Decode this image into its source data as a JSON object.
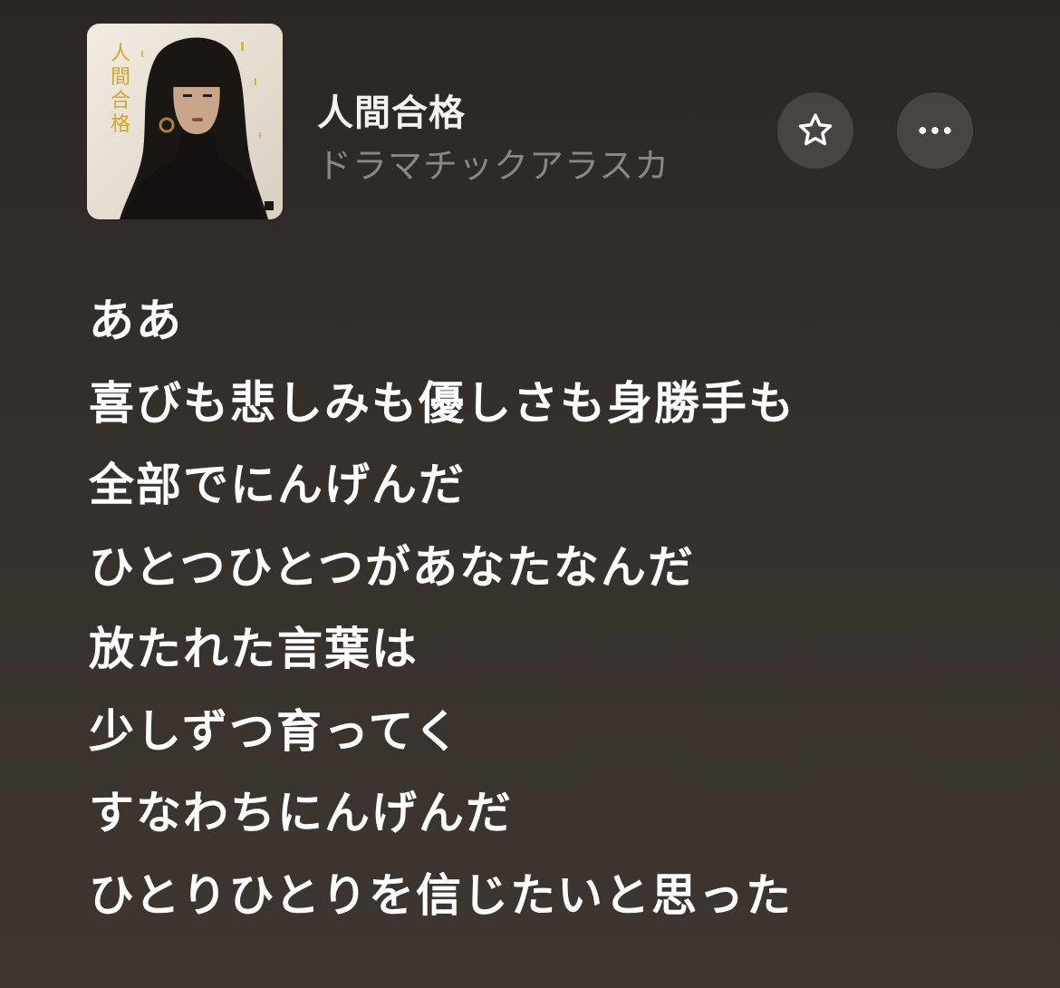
{
  "track": {
    "title": "人間合格",
    "artist": "ドラマチックアラスカ",
    "artwork_text": "人間合格"
  },
  "icons": {
    "favorite": "star-outline-icon",
    "more": "ellipsis-icon"
  },
  "colors": {
    "background": "#2f2a26",
    "title": "#f4f2ef",
    "artist": "#8d8680",
    "lyrics": "#ffffff",
    "button_bg": "rgba(255,255,255,0.13)"
  },
  "lyrics": [
    "ああ",
    "喜びも悲しみも優しさも身勝手も",
    "全部でにんげんだ",
    "ひとつひとつがあなたなんだ",
    "放たれた言葉は",
    "少しずつ育ってく",
    "すなわちにんげんだ",
    "ひとりひとりを信じたいと思った"
  ]
}
